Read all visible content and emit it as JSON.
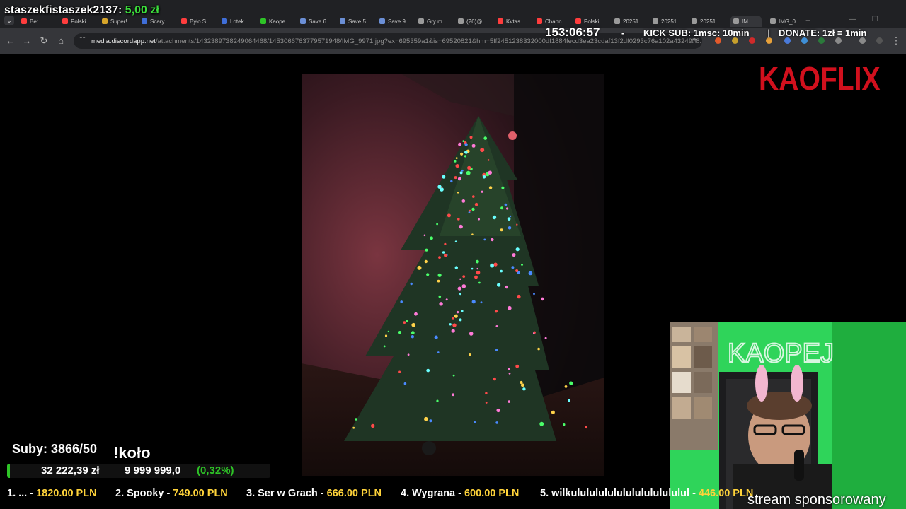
{
  "browser": {
    "tabs": [
      {
        "label": "Be:",
        "color": "#ff3d3d"
      },
      {
        "label": "Polski",
        "color": "#ff3d3d"
      },
      {
        "label": "Super!",
        "color": "#d7a52a"
      },
      {
        "label": "Scary",
        "color": "#3f6ed8"
      },
      {
        "label": "Było S",
        "color": "#ff3d3d"
      },
      {
        "label": "Lotek",
        "color": "#3f6ed8"
      },
      {
        "label": "Kaope",
        "color": "#2ec427"
      },
      {
        "label": "Save 6",
        "color": "#6b8fd6"
      },
      {
        "label": "Save 5",
        "color": "#6b8fd6"
      },
      {
        "label": "Save 9",
        "color": "#6b8fd6"
      },
      {
        "label": "Gry m",
        "color": "#9a9a9a"
      },
      {
        "label": "(26)@",
        "color": "#9a9a9a"
      },
      {
        "label": "Kvtas",
        "color": "#ff3d3d"
      },
      {
        "label": "Chann",
        "color": "#ff3d3d"
      },
      {
        "label": "Polski",
        "color": "#ff3d3d"
      },
      {
        "label": "20251",
        "color": "#9a9a9a"
      },
      {
        "label": "20251",
        "color": "#9a9a9a"
      },
      {
        "label": "20251",
        "color": "#9a9a9a"
      },
      {
        "label": "IM",
        "color": "#9a9a9a"
      },
      {
        "label": "IMG_0",
        "color": "#9a9a9a"
      }
    ],
    "url_host": "media.discordapp.net",
    "url_path": "/attachments/1432389738249064468/1453066763779571948/IMG_9971.jpg?ex=695359a1&is=69520821&hm=5ff2451238332000df1884fecd3ea23cdaf13f2df0293c76a102a4324978..."
  },
  "donation": {
    "donor": "staszekfistaszek2137:",
    "amount": "5,00 zł"
  },
  "overlay": {
    "timer": "153:06:57",
    "dash": "-",
    "kick_sub": "KICK SUB: 1msc: 10min",
    "separator": "|",
    "donate": "DONATE: 1zł = 1min",
    "logo": "KAOFLIX",
    "stream_sponsored": "stream sponsorowany"
  },
  "subs": {
    "label": "Suby: 3866/50",
    "kolo": "!koło",
    "goal_current": "32 222,39 zł",
    "goal_target": "9 999 999,0",
    "goal_percent_text": "(0,32%)",
    "goal_fraction": 0.0032
  },
  "leaderboard": [
    {
      "rank_name": "1. ... -",
      "amount": "1820.00 PLN"
    },
    {
      "rank_name": "2. Spooky -",
      "amount": "749.00 PLN"
    },
    {
      "rank_name": "3. Ser w Grach -",
      "amount": "666.00 PLN"
    },
    {
      "rank_name": "4. Wygrana -",
      "amount": "600.00 PLN"
    },
    {
      "rank_name": "5. wilkululululululululululululul -",
      "amount": "446.00 PLN"
    }
  ]
}
